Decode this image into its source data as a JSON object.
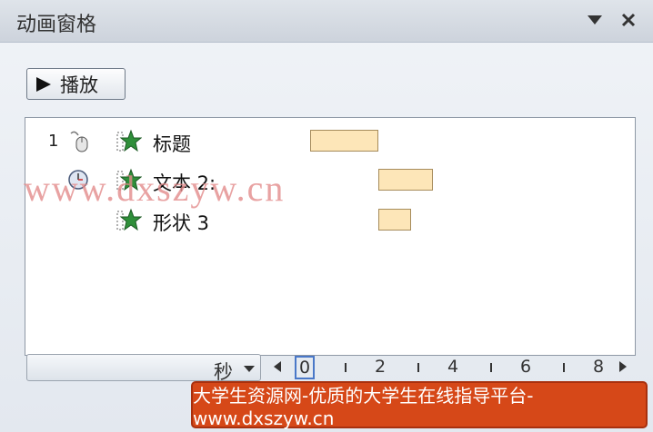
{
  "pane": {
    "title": "动画窗格",
    "play_label": "播放"
  },
  "rows": [
    {
      "num": "1",
      "trigger_icon": "mouse-click-icon",
      "label": "标题"
    },
    {
      "num": "",
      "trigger_icon": "clock-icon",
      "label": "文本 2:"
    },
    {
      "num": "",
      "trigger_icon": "",
      "label": "形状 3"
    }
  ],
  "timeline": {
    "unit_label": "秒",
    "ticks": [
      "0",
      "2",
      "4",
      "6",
      "8"
    ]
  },
  "watermark": "www.dxszyw.cn",
  "banner": "大学生资源网-优质的大学生在线指导平台-www.dxszyw.cn",
  "colors": {
    "bar_fill": "#fde6b8",
    "banner_bg": "#d64818",
    "effect_star": "#2f8f3a"
  }
}
